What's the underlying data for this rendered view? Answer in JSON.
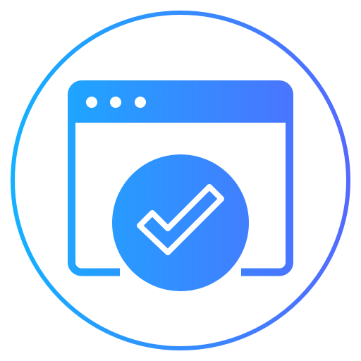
{
  "icon": {
    "name": "browser-window-check-icon",
    "colors": {
      "gradient_start": "#12B3FF",
      "gradient_end": "#5667FF",
      "background": "#FFFFFF"
    }
  }
}
